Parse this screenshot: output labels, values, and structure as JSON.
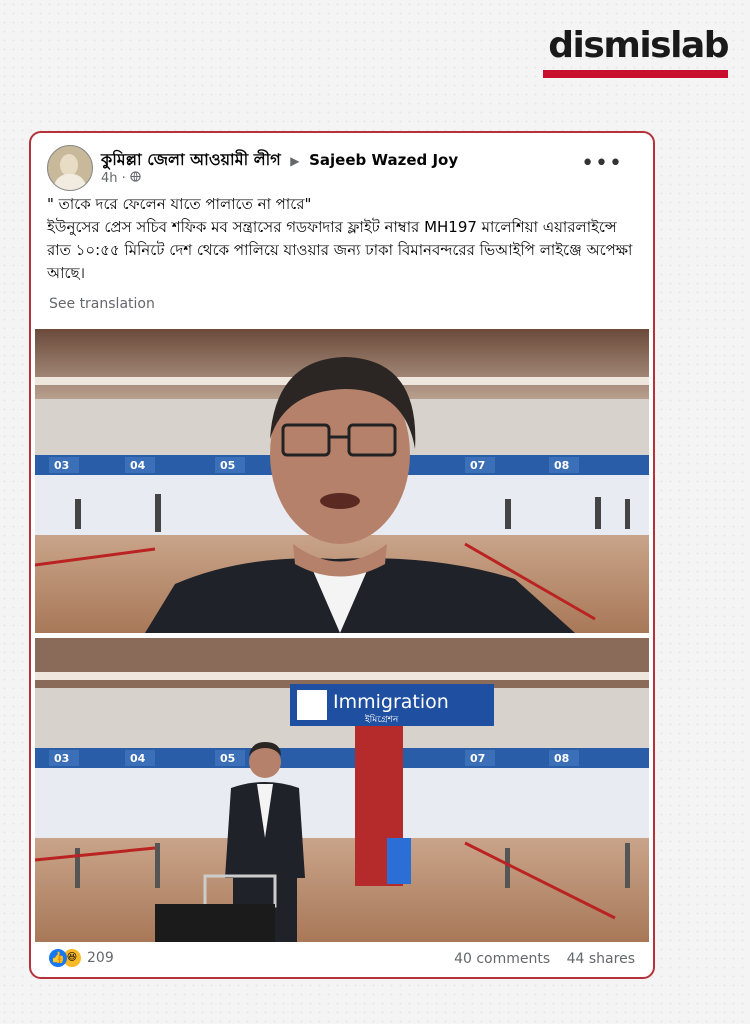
{
  "brand": {
    "logo_text": "dismislab",
    "accent_color": "#c8102e"
  },
  "post": {
    "group_name": "কুমিল্লা জেলা আওয়ামী লীগ",
    "page_name": "Sajeeb Wazed Joy",
    "time": "4h",
    "audience_icon": "globe-icon",
    "body_quote": "\" তাকে দরে ফেলেন যাতে পালাতে না পারে\"",
    "body_text": "ইউনুসের প্রেস সচিব শফিক  মব সন্ত্রাসের গডফাদার ফ্লাইট নাম্বার  MH197 মালেশিয়া এয়ারলাইন্সে রাত ১০:৫৫ মিনিটে দেশ থেকে পালিয়ে যাওয়ার জন্য ঢাকা বিমানবন্দরের ভিআইপি লাইঞ্জে অপেক্ষা আছে।",
    "see_translation": "See translation",
    "reaction_count": "209",
    "comments": "40 comments",
    "shares": "44 shares"
  },
  "images": {
    "counter_labels": [
      "03",
      "04",
      "05",
      "07",
      "08"
    ],
    "immigration_sign": "Immigration",
    "immigration_sign_bn": "ইমিগ্রেশন"
  }
}
